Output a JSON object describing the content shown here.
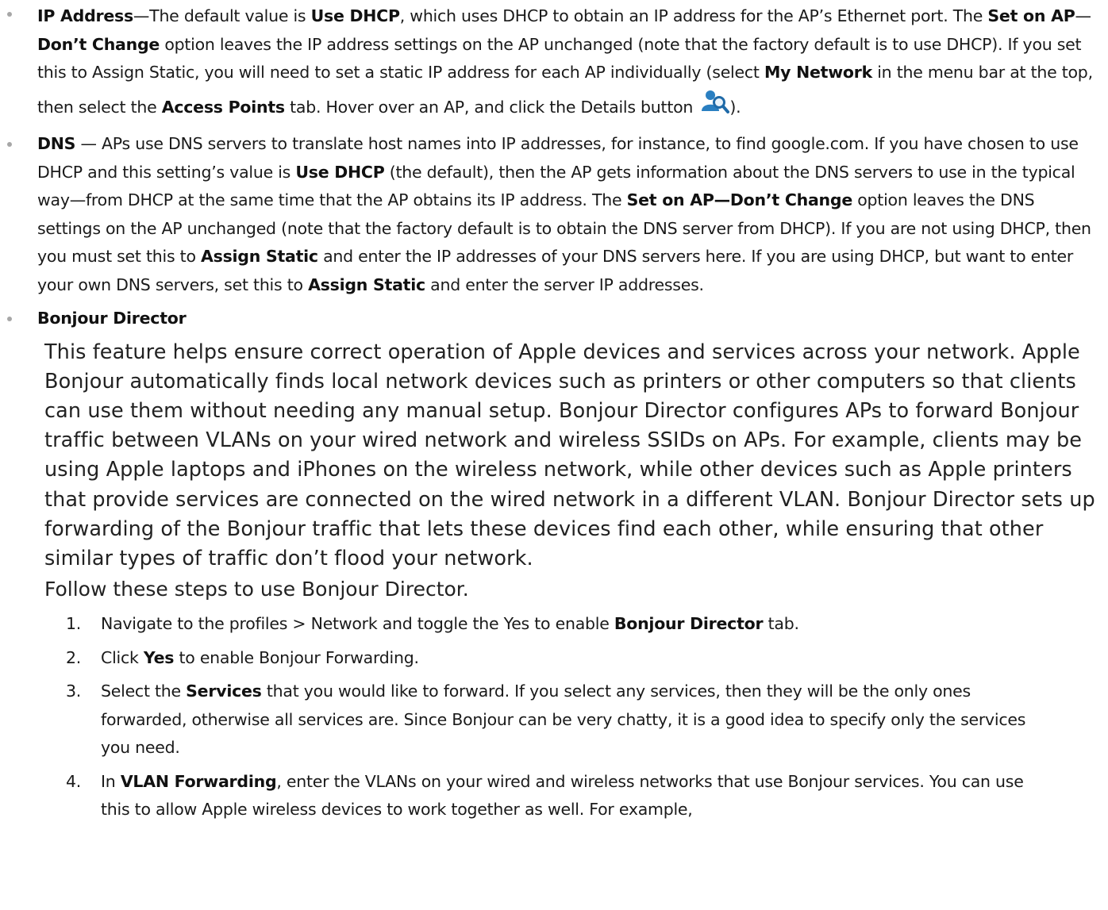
{
  "ip_address": {
    "term": "IP Address",
    "t1": "—The default value is ",
    "b1": "Use DHCP",
    "t2": ", which uses DHCP to obtain an IP address for the AP’s Ethernet port. The ",
    "b2": "Set on AP",
    "t3": "—",
    "b3": "Don’t Change",
    "t4": " option leaves the IP address settings on the AP unchanged (note that the factory default is to use DHCP). If you set this to Assign Static, you will need to set a static IP address for each AP individually (select ",
    "b4": "My Network",
    "t5": " in the menu bar at the top, then select the ",
    "b5": "Access Points",
    "t6": " tab. Hover over an AP, and click the Details button ",
    "t7": ")."
  },
  "dns": {
    "term": "DNS",
    "t1": " — APs use DNS servers to translate host names into IP addresses, for instance, to find google.com. If you have chosen to use DHCP and this setting’s value is ",
    "b1": "Use DHCP",
    "t2": " (the default), then the AP gets information about the DNS servers to use in the typical way—from DHCP at the same time that the AP obtains its IP address. The ",
    "b2": "Set on AP—Don’t Change",
    "t3": " option leaves the DNS settings on the AP unchanged (note that the factory default is to obtain the DNS server from DHCP). If you are not using DHCP, then you must set this to ",
    "b3": "Assign Static",
    "t4": " and enter the IP addresses of your DNS servers here. If you are using DHCP, but want to enter your own DNS servers, set this to ",
    "b4": "Assign Static",
    "t5": " and enter the server IP addresses."
  },
  "bonjour": {
    "term": "Bonjour Director",
    "description": "This feature helps ensure correct operation of Apple devices and services across your network. Apple Bonjour automatically finds local network devices such as printers or other computers so that clients can use them without needing any manual setup. Bonjour Director configures APs to forward Bonjour traffic between VLANs on your wired network and wireless SSIDs on APs. For example, clients may be using Apple laptops and iPhones on the wireless network, while other devices such as Apple printers that provide services are connected on the wired network in a different VLAN. Bonjour Director sets up forwarding of the Bonjour traffic that lets these devices find each other, while ensuring that other similar types of traffic don’t flood your network.",
    "follow": "Follow these steps to use Bonjour Director.",
    "steps": [
      {
        "num": "1.",
        "t1": "Navigate to the profiles > Network and toggle the Yes to enable ",
        "b1": "Bonjour Director",
        "t2": " tab."
      },
      {
        "num": "2.",
        "t1": "Click ",
        "b1": "Yes",
        "t2": " to enable Bonjour Forwarding."
      },
      {
        "num": "3.",
        "t1": "Select the ",
        "b1": "Services",
        "t2": " that you would like to forward. If you select any services, then they will be the only ones forwarded, otherwise all services are. Since Bonjour can be very chatty, it is a good idea to specify only the services you need."
      },
      {
        "num": "4.",
        "t1": "In ",
        "b1": "VLAN Forwarding",
        "t2": ", enter the VLANs on your wired and wireless networks that use Bonjour services. You can use this to allow Apple wireless devices to work together as well. For example,"
      }
    ]
  },
  "icons": {
    "details": "details-user-search-icon"
  },
  "colors": {
    "icon_blue": "#2a7fc1",
    "bullet": "#a7a7a7",
    "text": "#1a1a1a"
  }
}
